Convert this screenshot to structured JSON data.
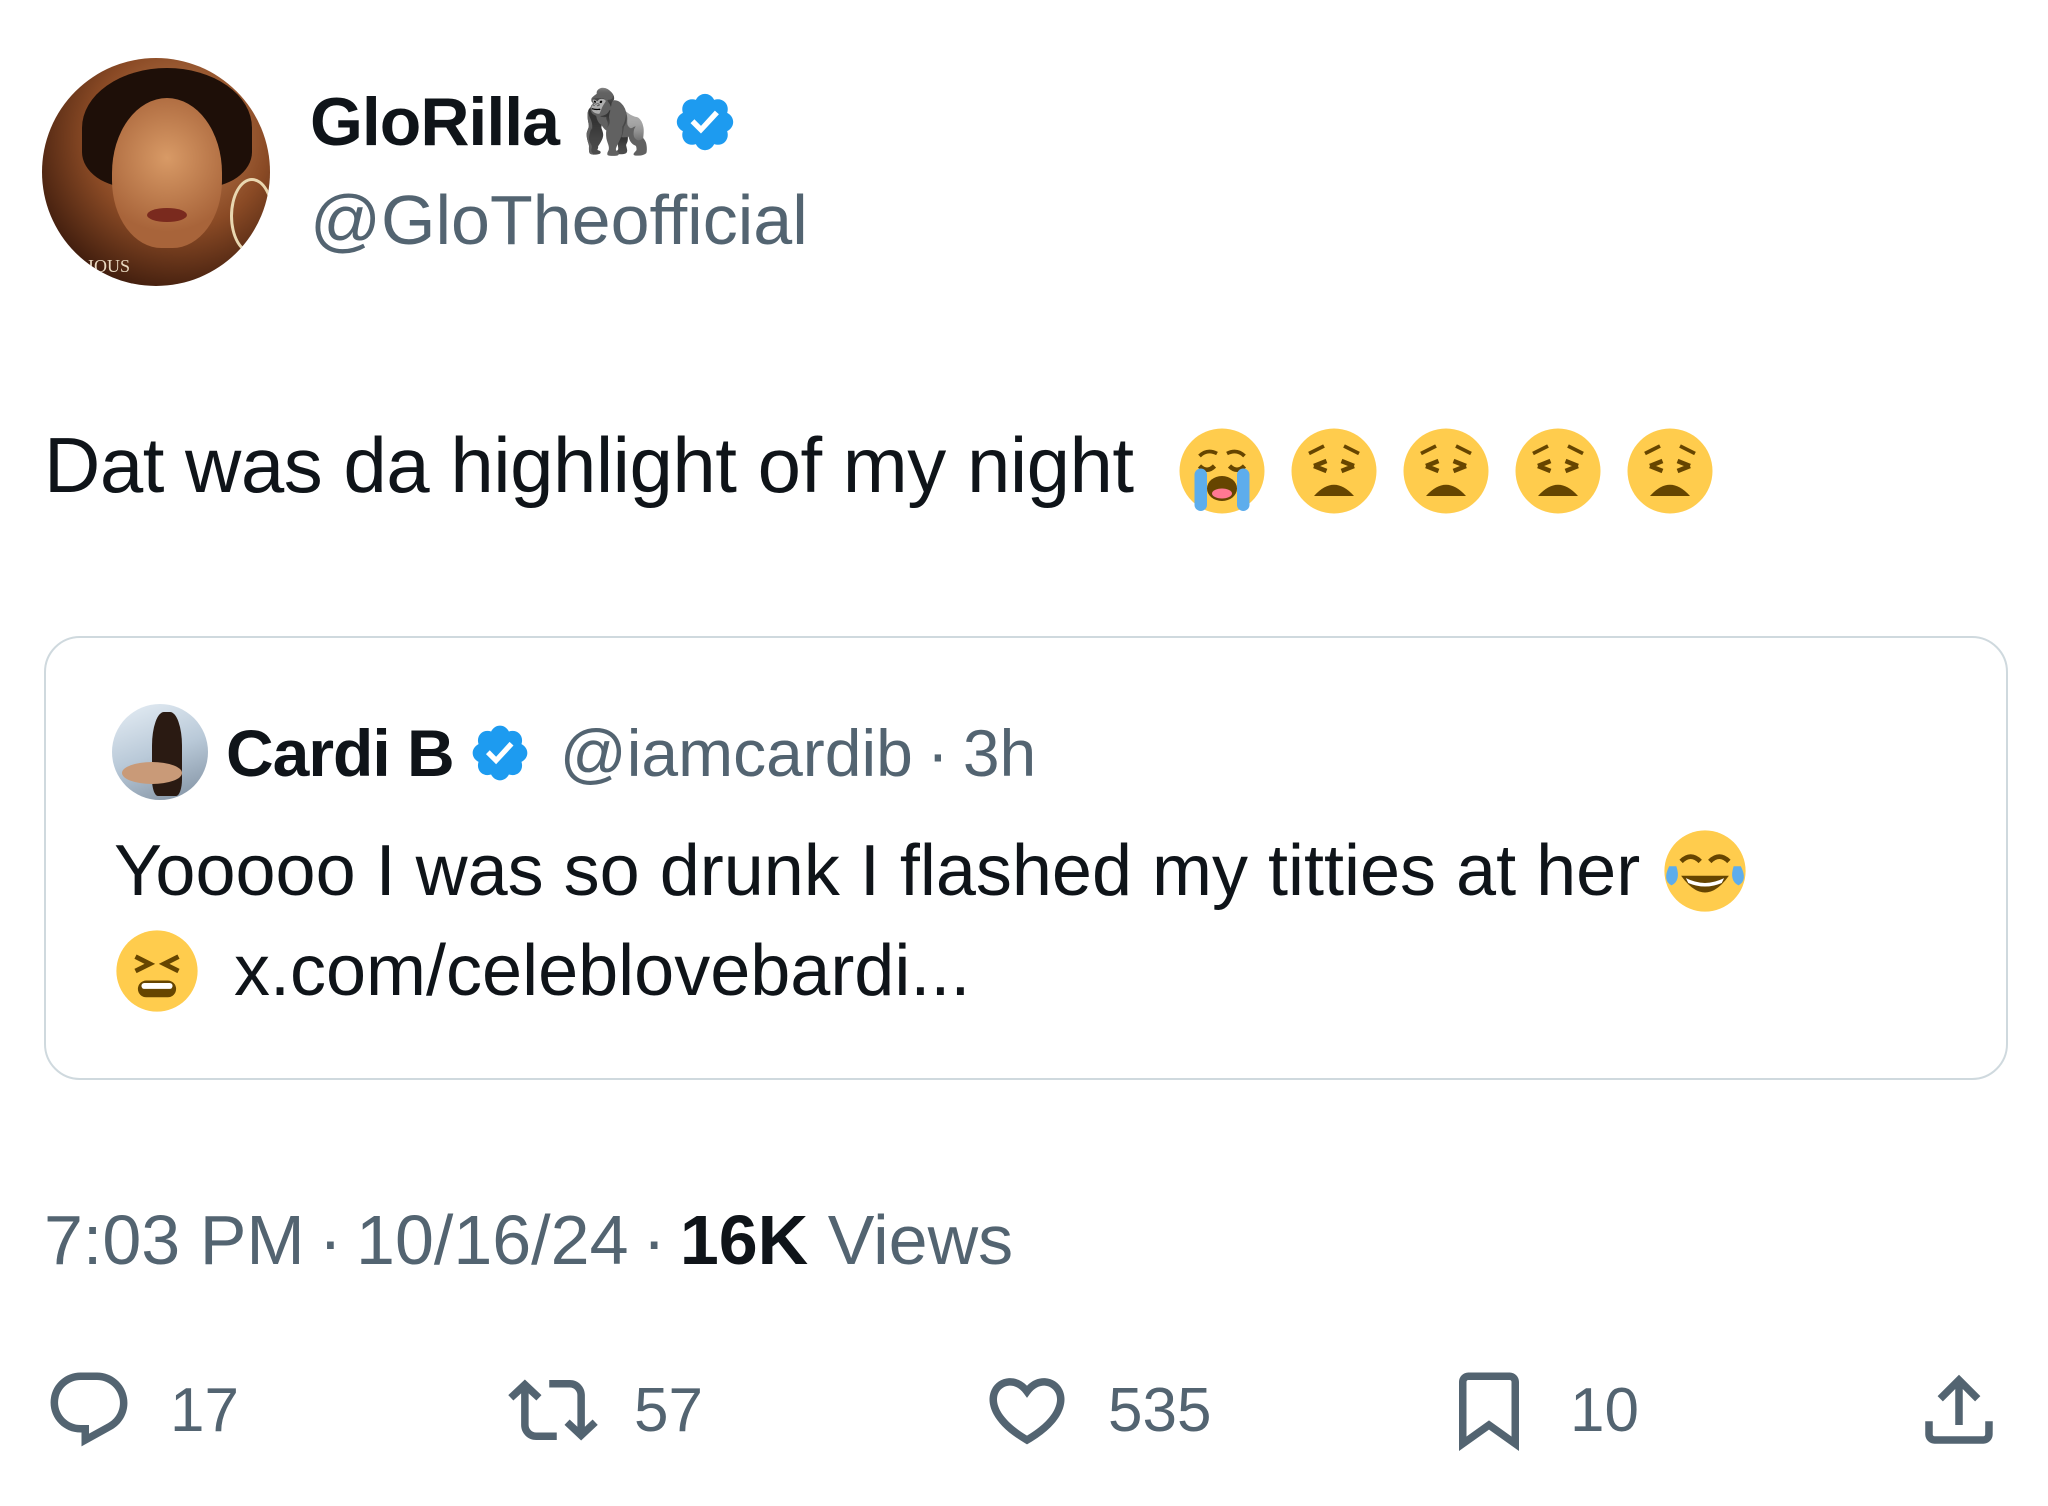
{
  "author": {
    "display_name": "GloRilla",
    "name_emoji": "🦍",
    "handle": "@GloTheofficial",
    "avatar_caption": "IOUS"
  },
  "post": {
    "text": "Dat was da highlight of my night",
    "emojis": [
      "crying-face",
      "weary-face",
      "weary-face",
      "weary-face",
      "weary-face"
    ]
  },
  "quoted": {
    "display_name": "Cardi B",
    "handle": "@iamcardib",
    "dot": "·",
    "time": "3h",
    "text": "Yooooo I was so drunk I flashed my titties at her",
    "link": "x.com/celeblovebardi..."
  },
  "meta": {
    "time": "7:03 PM",
    "sep1": "·",
    "date": "10/16/24",
    "sep2": "·",
    "views_count": "16K",
    "views_label": "Views"
  },
  "actions": {
    "replies": "17",
    "reposts": "57",
    "likes": "535",
    "bookmarks": "10"
  },
  "colors": {
    "text": "#0f1419",
    "secondary": "#536471",
    "verified": "#1d9bf0",
    "border": "#cfd9de"
  }
}
